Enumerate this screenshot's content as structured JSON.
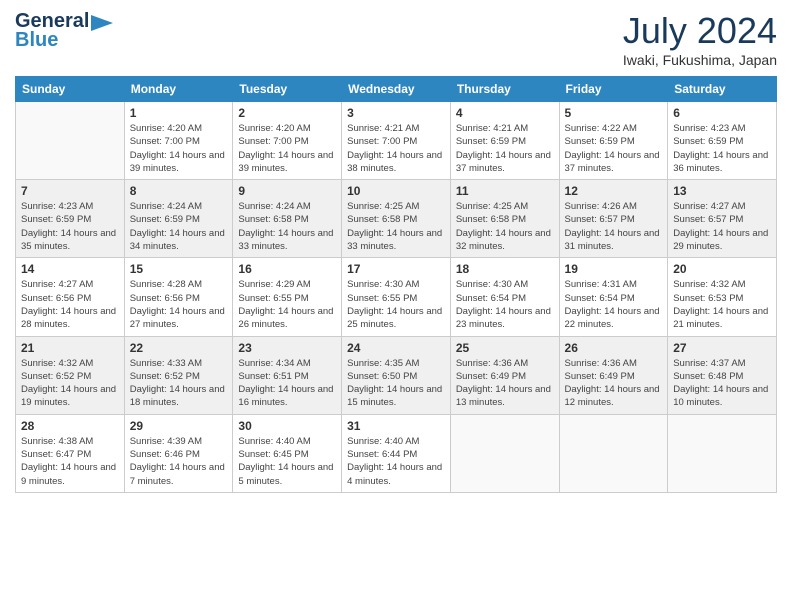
{
  "logo": {
    "line1": "General",
    "line2": "Blue",
    "arrow": "▶"
  },
  "title": "July 2024",
  "location": "Iwaki, Fukushima, Japan",
  "days_of_week": [
    "Sunday",
    "Monday",
    "Tuesday",
    "Wednesday",
    "Thursday",
    "Friday",
    "Saturday"
  ],
  "weeks": [
    [
      {
        "day": "",
        "sunrise": "",
        "sunset": "",
        "daylight": ""
      },
      {
        "day": "1",
        "sunrise": "Sunrise: 4:20 AM",
        "sunset": "Sunset: 7:00 PM",
        "daylight": "Daylight: 14 hours and 39 minutes."
      },
      {
        "day": "2",
        "sunrise": "Sunrise: 4:20 AM",
        "sunset": "Sunset: 7:00 PM",
        "daylight": "Daylight: 14 hours and 39 minutes."
      },
      {
        "day": "3",
        "sunrise": "Sunrise: 4:21 AM",
        "sunset": "Sunset: 7:00 PM",
        "daylight": "Daylight: 14 hours and 38 minutes."
      },
      {
        "day": "4",
        "sunrise": "Sunrise: 4:21 AM",
        "sunset": "Sunset: 6:59 PM",
        "daylight": "Daylight: 14 hours and 37 minutes."
      },
      {
        "day": "5",
        "sunrise": "Sunrise: 4:22 AM",
        "sunset": "Sunset: 6:59 PM",
        "daylight": "Daylight: 14 hours and 37 minutes."
      },
      {
        "day": "6",
        "sunrise": "Sunrise: 4:23 AM",
        "sunset": "Sunset: 6:59 PM",
        "daylight": "Daylight: 14 hours and 36 minutes."
      }
    ],
    [
      {
        "day": "7",
        "sunrise": "Sunrise: 4:23 AM",
        "sunset": "Sunset: 6:59 PM",
        "daylight": "Daylight: 14 hours and 35 minutes."
      },
      {
        "day": "8",
        "sunrise": "Sunrise: 4:24 AM",
        "sunset": "Sunset: 6:59 PM",
        "daylight": "Daylight: 14 hours and 34 minutes."
      },
      {
        "day": "9",
        "sunrise": "Sunrise: 4:24 AM",
        "sunset": "Sunset: 6:58 PM",
        "daylight": "Daylight: 14 hours and 33 minutes."
      },
      {
        "day": "10",
        "sunrise": "Sunrise: 4:25 AM",
        "sunset": "Sunset: 6:58 PM",
        "daylight": "Daylight: 14 hours and 33 minutes."
      },
      {
        "day": "11",
        "sunrise": "Sunrise: 4:25 AM",
        "sunset": "Sunset: 6:58 PM",
        "daylight": "Daylight: 14 hours and 32 minutes."
      },
      {
        "day": "12",
        "sunrise": "Sunrise: 4:26 AM",
        "sunset": "Sunset: 6:57 PM",
        "daylight": "Daylight: 14 hours and 31 minutes."
      },
      {
        "day": "13",
        "sunrise": "Sunrise: 4:27 AM",
        "sunset": "Sunset: 6:57 PM",
        "daylight": "Daylight: 14 hours and 29 minutes."
      }
    ],
    [
      {
        "day": "14",
        "sunrise": "Sunrise: 4:27 AM",
        "sunset": "Sunset: 6:56 PM",
        "daylight": "Daylight: 14 hours and 28 minutes."
      },
      {
        "day": "15",
        "sunrise": "Sunrise: 4:28 AM",
        "sunset": "Sunset: 6:56 PM",
        "daylight": "Daylight: 14 hours and 27 minutes."
      },
      {
        "day": "16",
        "sunrise": "Sunrise: 4:29 AM",
        "sunset": "Sunset: 6:55 PM",
        "daylight": "Daylight: 14 hours and 26 minutes."
      },
      {
        "day": "17",
        "sunrise": "Sunrise: 4:30 AM",
        "sunset": "Sunset: 6:55 PM",
        "daylight": "Daylight: 14 hours and 25 minutes."
      },
      {
        "day": "18",
        "sunrise": "Sunrise: 4:30 AM",
        "sunset": "Sunset: 6:54 PM",
        "daylight": "Daylight: 14 hours and 23 minutes."
      },
      {
        "day": "19",
        "sunrise": "Sunrise: 4:31 AM",
        "sunset": "Sunset: 6:54 PM",
        "daylight": "Daylight: 14 hours and 22 minutes."
      },
      {
        "day": "20",
        "sunrise": "Sunrise: 4:32 AM",
        "sunset": "Sunset: 6:53 PM",
        "daylight": "Daylight: 14 hours and 21 minutes."
      }
    ],
    [
      {
        "day": "21",
        "sunrise": "Sunrise: 4:32 AM",
        "sunset": "Sunset: 6:52 PM",
        "daylight": "Daylight: 14 hours and 19 minutes."
      },
      {
        "day": "22",
        "sunrise": "Sunrise: 4:33 AM",
        "sunset": "Sunset: 6:52 PM",
        "daylight": "Daylight: 14 hours and 18 minutes."
      },
      {
        "day": "23",
        "sunrise": "Sunrise: 4:34 AM",
        "sunset": "Sunset: 6:51 PM",
        "daylight": "Daylight: 14 hours and 16 minutes."
      },
      {
        "day": "24",
        "sunrise": "Sunrise: 4:35 AM",
        "sunset": "Sunset: 6:50 PM",
        "daylight": "Daylight: 14 hours and 15 minutes."
      },
      {
        "day": "25",
        "sunrise": "Sunrise: 4:36 AM",
        "sunset": "Sunset: 6:49 PM",
        "daylight": "Daylight: 14 hours and 13 minutes."
      },
      {
        "day": "26",
        "sunrise": "Sunrise: 4:36 AM",
        "sunset": "Sunset: 6:49 PM",
        "daylight": "Daylight: 14 hours and 12 minutes."
      },
      {
        "day": "27",
        "sunrise": "Sunrise: 4:37 AM",
        "sunset": "Sunset: 6:48 PM",
        "daylight": "Daylight: 14 hours and 10 minutes."
      }
    ],
    [
      {
        "day": "28",
        "sunrise": "Sunrise: 4:38 AM",
        "sunset": "Sunset: 6:47 PM",
        "daylight": "Daylight: 14 hours and 9 minutes."
      },
      {
        "day": "29",
        "sunrise": "Sunrise: 4:39 AM",
        "sunset": "Sunset: 6:46 PM",
        "daylight": "Daylight: 14 hours and 7 minutes."
      },
      {
        "day": "30",
        "sunrise": "Sunrise: 4:40 AM",
        "sunset": "Sunset: 6:45 PM",
        "daylight": "Daylight: 14 hours and 5 minutes."
      },
      {
        "day": "31",
        "sunrise": "Sunrise: 4:40 AM",
        "sunset": "Sunset: 6:44 PM",
        "daylight": "Daylight: 14 hours and 4 minutes."
      },
      {
        "day": "",
        "sunrise": "",
        "sunset": "",
        "daylight": ""
      },
      {
        "day": "",
        "sunrise": "",
        "sunset": "",
        "daylight": ""
      },
      {
        "day": "",
        "sunrise": "",
        "sunset": "",
        "daylight": ""
      }
    ]
  ]
}
